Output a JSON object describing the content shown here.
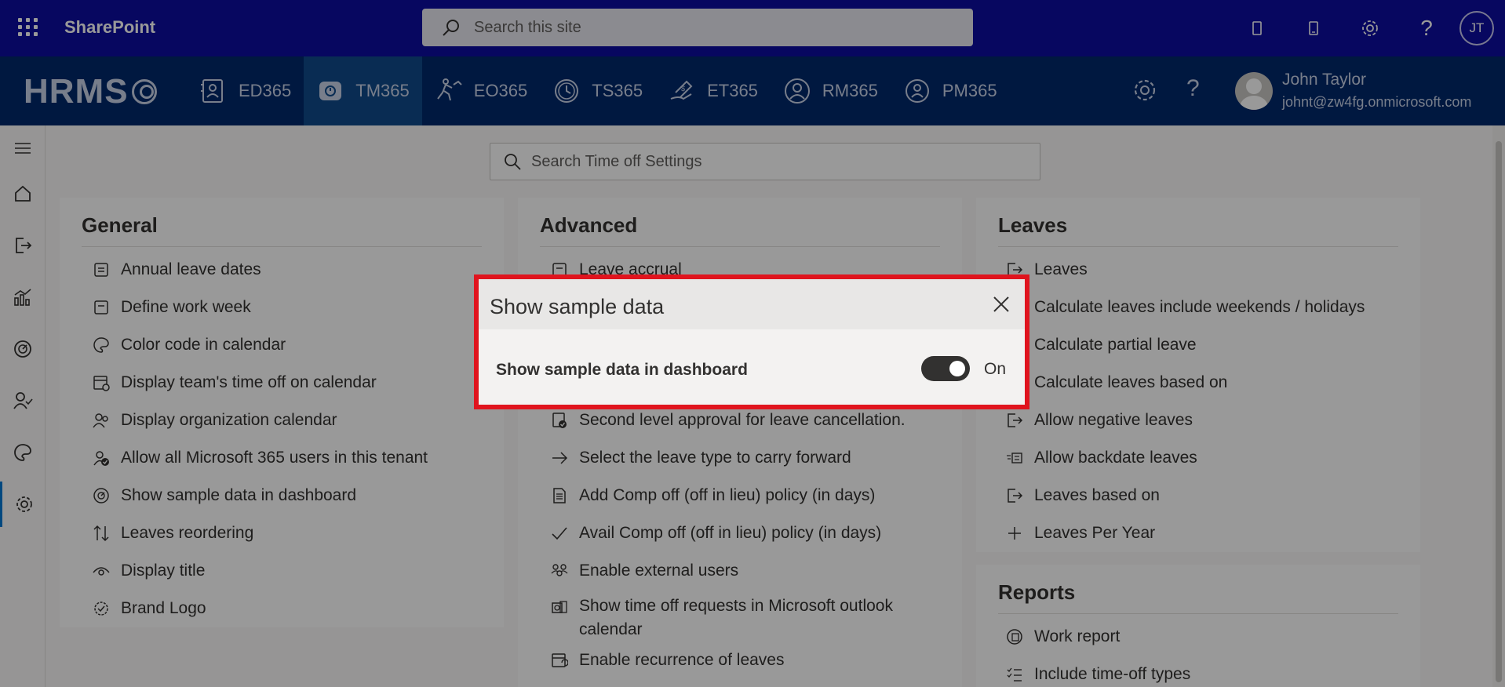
{
  "suitebar": {
    "title": "SharePoint",
    "search_placeholder": "Search this site",
    "avatar_initials": "JT"
  },
  "appbar": {
    "logo_text": "HRMS",
    "tabs": [
      {
        "label": "ED365",
        "icon": "employee-directory-icon"
      },
      {
        "label": "TM365",
        "icon": "time-off-icon",
        "active": true
      },
      {
        "label": "EO365",
        "icon": "onboarding-icon"
      },
      {
        "label": "TS365",
        "icon": "timesheet-icon"
      },
      {
        "label": "ET365",
        "icon": "expense-icon"
      },
      {
        "label": "RM365",
        "icon": "recruitment-icon"
      },
      {
        "label": "PM365",
        "icon": "performance-icon"
      }
    ],
    "user": {
      "name": "John Taylor",
      "email": "johnt@zw4fg.onmicrosoft.com"
    }
  },
  "settings_search": {
    "placeholder": "Search Time off Settings"
  },
  "general": {
    "title": "General",
    "items": [
      "Annual leave dates",
      "Define work week",
      "Color code in calendar",
      "Display team's time off on calendar",
      "Display organization calendar",
      "Allow all Microsoft 365 users in this tenant",
      "Show sample data in dashboard",
      "Leaves reordering",
      "Display title",
      "Brand Logo"
    ]
  },
  "advanced": {
    "title": "Advanced",
    "items": [
      "Leave accrual",
      "Second level approval for leave cancellation.",
      "Select the leave type to carry forward",
      "Add Comp off (off in lieu) policy (in days)",
      "Avail Comp off (off in lieu) policy (in days)",
      "Enable external users",
      "Show time off requests in Microsoft outlook calendar",
      "Enable recurrence of leaves"
    ]
  },
  "leaves": {
    "title": "Leaves",
    "items": [
      "Leaves",
      "Calculate leaves include weekends / holidays",
      "Calculate partial leave",
      "Calculate leaves based on",
      "Allow negative leaves",
      "Allow backdate leaves",
      "Leaves based on",
      "Leaves Per Year"
    ]
  },
  "reports": {
    "title": "Reports",
    "items": [
      "Work report",
      "Include time-off types"
    ]
  },
  "dialog": {
    "title": "Show sample data",
    "label": "Show sample data in dashboard",
    "toggle_state": "On"
  },
  "colors": {
    "suitebar": "#0c0ca0",
    "appbar": "#00296b",
    "dialog_border": "#e0141e"
  }
}
